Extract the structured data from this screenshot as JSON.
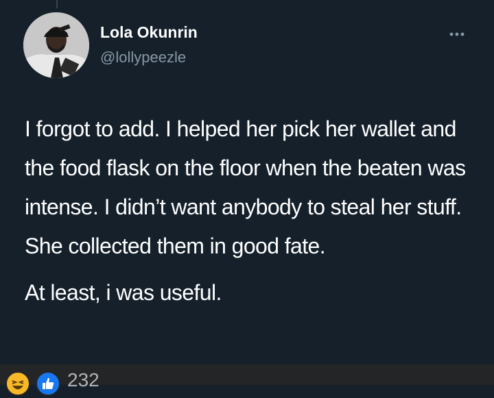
{
  "tweet": {
    "author_name": "Lola Okunrin",
    "author_handle": "@lollypeezle",
    "more_icon": "more-horizontal-icon",
    "paragraphs": [
      "I forgot to add. I helped her pick her wallet and the food flask on the floor when the beaten was intense. I didn’t want anybody to steal her stuff. She collected them in good fate.",
      "At least, i was useful."
    ]
  },
  "reactions": {
    "icons": [
      "haha-reaction-icon",
      "like-reaction-icon"
    ],
    "count": "232"
  },
  "colors": {
    "background": "#15202b",
    "secondary_text": "#8899a6",
    "reaction_bar": "#242526",
    "like_blue": "#1877f2",
    "haha_yellow": "#f7b928"
  }
}
